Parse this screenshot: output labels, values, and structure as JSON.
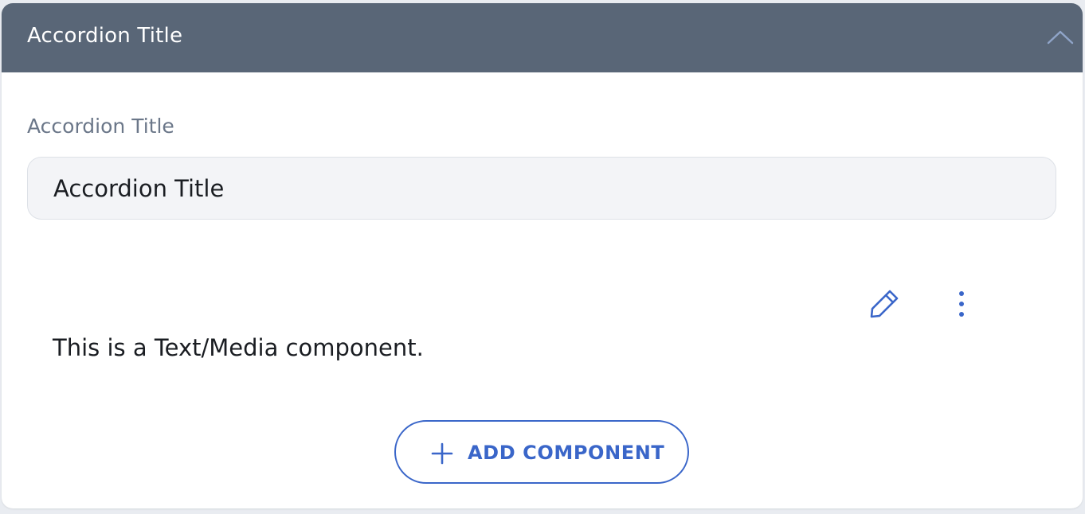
{
  "accordion": {
    "header_title": "Accordion Title",
    "expanded": true,
    "toggle_icon": "chevron-up-icon"
  },
  "form": {
    "title_label": "Accordion Title",
    "title_value": "Accordion Title"
  },
  "component": {
    "text": "This is a Text/Media component.",
    "edit_icon": "pencil-icon",
    "more_icon": "more-vertical-icon"
  },
  "add_component": {
    "label": "ADD COMPONENT",
    "icon": "plus-icon"
  },
  "colors": {
    "header_bg": "#596677",
    "accent": "#3a66c9",
    "input_bg": "#f3f4f7",
    "label": "#6b7789",
    "page_bg": "#e9ecf1"
  }
}
